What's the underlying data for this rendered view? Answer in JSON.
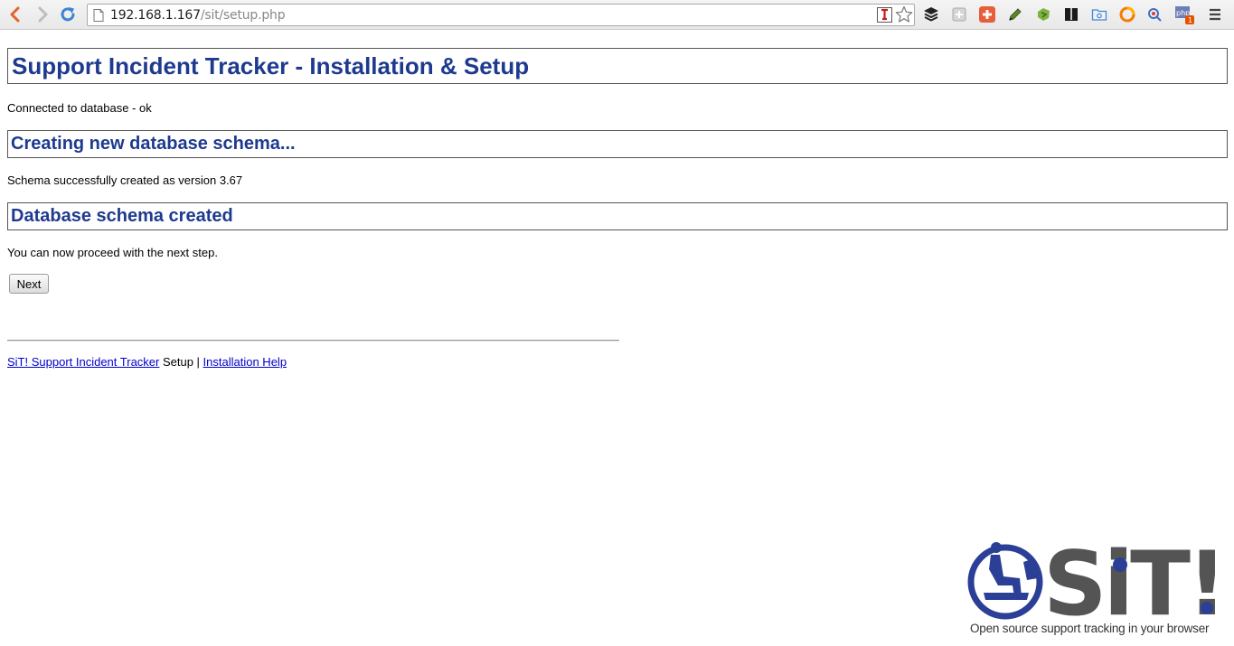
{
  "browser": {
    "url_host": "192.168.1.167",
    "url_path": "/sit/setup.php"
  },
  "page": {
    "title": "Support Incident Tracker - Installation & Setup",
    "connected_message": "Connected to database - ok",
    "section1_heading": "Creating new database schema...",
    "schema_message": "Schema successfully created as version 3.67",
    "section2_heading": "Database schema created",
    "proceed_message": "You can now proceed with the next step.",
    "next_button_label": "Next"
  },
  "footer": {
    "link_sit": "SiT! Support Incident Tracker",
    "setup_text": " Setup | ",
    "link_help": "Installation Help"
  },
  "logo": {
    "wordmark": "SiT!",
    "tagline": "Open source support tracking in your browser"
  },
  "colors": {
    "heading": "#1e3a8f",
    "logo_blue": "#2b3f96",
    "logo_grey": "#545454",
    "link": "#0000cc"
  },
  "icons": [
    "back-arrow-icon",
    "forward-arrow-icon",
    "reload-icon",
    "page-icon",
    "pin-icon",
    "star-icon",
    "buffer-icon",
    "extension-icon",
    "plus-icon",
    "pen-icon",
    "evernote-icon",
    "bookmark-icon",
    "folder-icon",
    "firebug-icon",
    "search-icon",
    "php-icon",
    "menu-icon"
  ]
}
